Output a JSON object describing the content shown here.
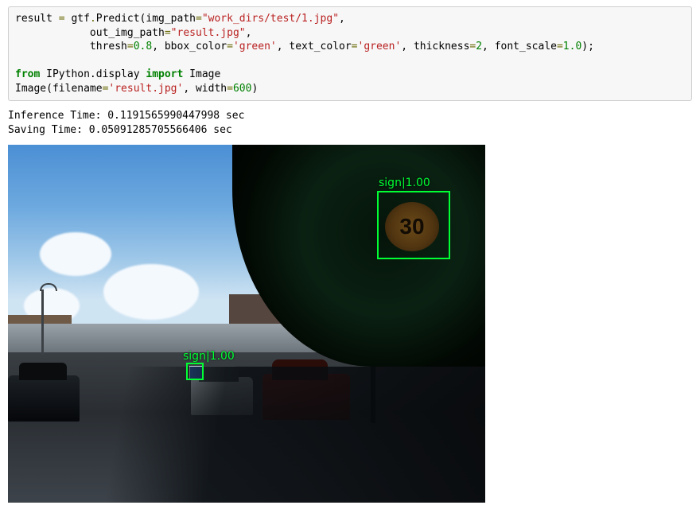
{
  "code": {
    "line1a": "result ",
    "op_eq": "=",
    "line1b": " gtf",
    "dot": ".",
    "predict": "Predict(img_path",
    "str_imgpath": "\"work_dirs/test/1.jpg\"",
    "comma": ",",
    "line2a": "            out_img_path",
    "str_outpath": "\"result.jpg\"",
    "line3a": "            thresh",
    "num_thresh": "0.8",
    "line3b": ", bbox_color",
    "str_green1": "'green'",
    "line3c": ", text_color",
    "str_green2": "'green'",
    "line3d": ", thickness",
    "num_thick": "2",
    "line3e": ", font_scale",
    "num_fs": "1.0",
    "line3f": ");",
    "blank": "",
    "kw_from": "from",
    "line5a": " IPython.display ",
    "kw_import": "import",
    "line5b": " Image",
    "line6a": "Image(filename",
    "str_result": "'result.jpg'",
    "line6b": ", width",
    "num_width": "600",
    "line6c": ")"
  },
  "output": {
    "inference": "Inference Time: 0.1191565990447998 sec",
    "saving": "Saving Time: 0.05091285705566406 sec"
  },
  "detections": {
    "big_label": "sign|1.00",
    "small_label": "sign|1.00",
    "sign_text": "30"
  }
}
